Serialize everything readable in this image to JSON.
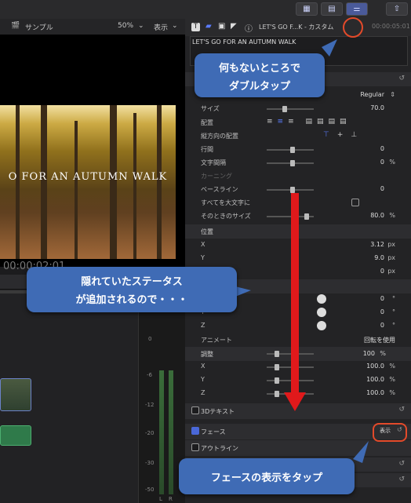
{
  "toolbar": {
    "share_icon": "share-icon"
  },
  "viewer": {
    "project_name": "サンプル",
    "zoom": "50%",
    "view_menu": "表示",
    "video_title": "O FOR AN AUTUMN WALK",
    "timecode": "00:00:02:01"
  },
  "inspector": {
    "title_text": "LET'S GO F...K - カスタム",
    "timecode": "00:00:05:01",
    "text_preview": "LET'S GO FOR AN AUTUMN WALK",
    "font_style": "Regular",
    "rows": {
      "size": {
        "label": "サイズ",
        "value": "70.0"
      },
      "align": {
        "label": "配置"
      },
      "valign": {
        "label": "縦方向の配置"
      },
      "line_spacing": {
        "label": "行間",
        "value": "0"
      },
      "tracking": {
        "label": "文字間隔",
        "value": "0",
        "unit": "%"
      },
      "kerning": {
        "label": "カーニング"
      },
      "baseline": {
        "label": "ベースライン",
        "value": "0"
      },
      "all_caps": {
        "label": "すべてを大文字に"
      },
      "caps_size": {
        "label": "そのときのサイズ",
        "value": "80.0",
        "unit": "%"
      }
    },
    "position": {
      "section": "位置",
      "x": {
        "label": "X",
        "value": "3.12",
        "unit": "px"
      },
      "y": {
        "label": "Y",
        "value": "9.0",
        "unit": "px"
      },
      "z": {
        "label": "Z",
        "value": "0",
        "unit": "px"
      }
    },
    "rotation": {
      "x": {
        "label": "X",
        "value": "0",
        "unit": "°"
      },
      "y": {
        "label": "Y",
        "value": "0",
        "unit": "°"
      },
      "z": {
        "label": "Z",
        "value": "0",
        "unit": "°"
      },
      "animate": {
        "label": "アニメート",
        "value": "回転を使用"
      }
    },
    "scale": {
      "section": "調整",
      "all": {
        "value": "100",
        "unit": "%"
      },
      "x": {
        "label": "X",
        "value": "100.0",
        "unit": "%"
      },
      "y": {
        "label": "Y",
        "value": "100.0",
        "unit": "%"
      },
      "z": {
        "label": "Z",
        "value": "100.0",
        "unit": "%"
      }
    },
    "text_3d": "3Dテキスト",
    "face": "フェース",
    "face_show": "表示",
    "face_show_tooltip": "表示",
    "outline": "アウトライン"
  },
  "meters": {
    "labels": [
      "0",
      "-6",
      "-12",
      "-20",
      "-30",
      "-50"
    ],
    "channels": [
      "L",
      "R"
    ]
  },
  "callouts": {
    "top_line1": "何もないところで",
    "top_line2": "ダブルタップ",
    "mid_line1": "隠れていたステータス",
    "mid_line2": "が追加されるので・・・",
    "bottom": "フェースの表示をタップ"
  },
  "colors": {
    "callout": "#3f6bb5",
    "arrow": "#e0191b",
    "ring": "#e34a2a",
    "accent": "#4a68d8"
  }
}
